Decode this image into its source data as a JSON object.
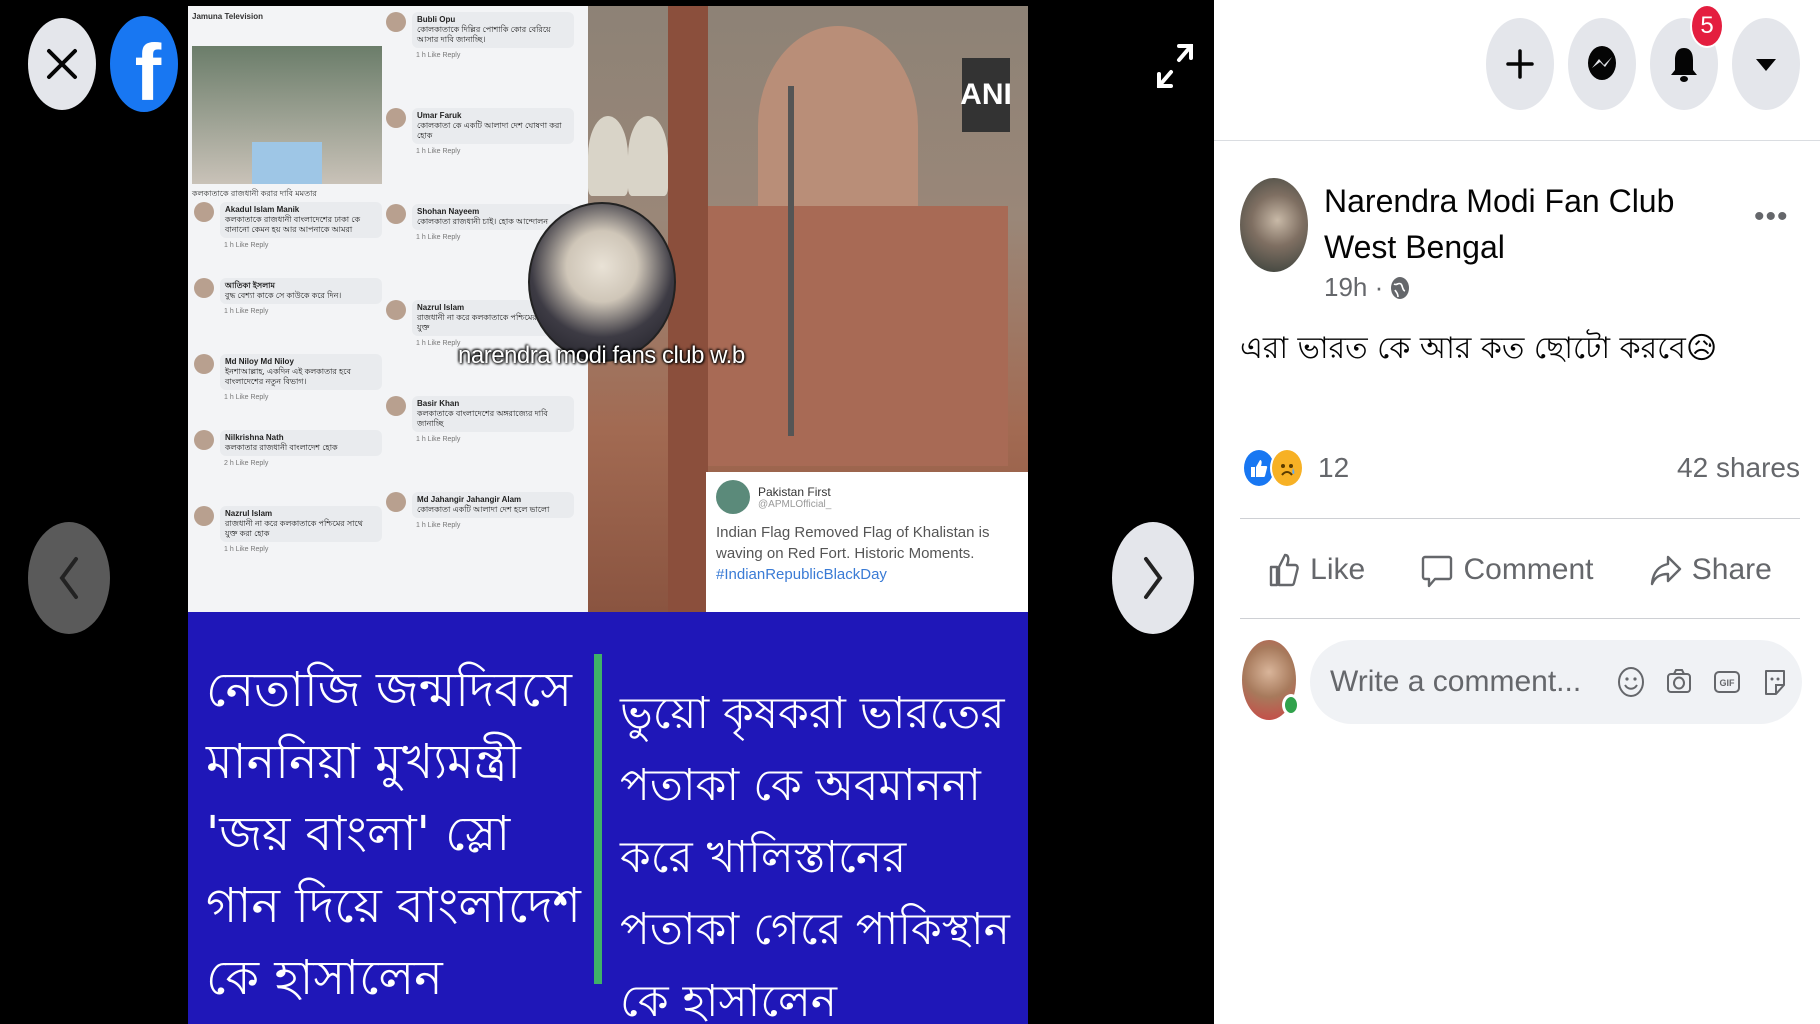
{
  "viewer": {
    "close_icon": "close-icon",
    "logo_icon": "facebook-logo",
    "logo_letter": "f",
    "expand_icon": "expand-icon",
    "prev_icon": "chevron-left-icon",
    "next_icon": "chevron-right-icon"
  },
  "post_image": {
    "news_header": "Jamuna Television",
    "news_caption": "কলকাতাকে রাজধানী করার দাবি মমতার",
    "comments_left": [
      {
        "name": "Akadul Islam Manik",
        "text": "কলকাতাকে রাজধানী বাংলাদেশের ঢাকা কে বানানো কেমন হয় আর আপনাকে আমরা",
        "meta": "1 h   Like   Reply"
      },
      {
        "name": "আতিকা ইসলাম",
        "text": "বুদ্ধ বেশ্যা কাকে সে কাউকে করে দিন।",
        "meta": "1 h   Like   Reply"
      },
      {
        "name": "Md Niloy Md Niloy",
        "text": "ইনশাআল্লাহ, একদিন এই কলকাতার হবে বাংলাদেশের নতুন বিভাগ।",
        "meta": "1 h   Like   Reply"
      },
      {
        "name": "Nilkrishna Nath",
        "text": "কলকাতার রাজধানী বাংলাদেশ হোক",
        "meta": "2 h   Like   Reply"
      },
      {
        "name": "Nazrul Islam",
        "text": "রাজধানী না করে কলকাতাকে পশ্চিমের সাথে যুক্ত করা হোক",
        "meta": "1 h   Like   Reply"
      }
    ],
    "comments_right": [
      {
        "name": "Bubli Opu",
        "text": "কোলকাতাকে দিল্লির পোশাকি কোর বেরিয়ে আসার দাবি জানাচ্ছি।",
        "meta": "1 h   Like   Reply"
      },
      {
        "name": "Umar Faruk",
        "text": "কোলকাতা কে একটি আলাদা দেশ ঘোষণা করা হোক",
        "meta": "1 h   Like   Reply"
      },
      {
        "name": "Shohan Nayeem",
        "text": "কোলকাতা রাজধানী চাই। হোক আন্দোলন",
        "meta": "1 h   Like   Reply"
      },
      {
        "name": "Nazrul Islam",
        "text": "রাজধানী না করে কলকাতাকে পশ্চিমের সাথে যুক্ত",
        "meta": "1 h   Like   Reply"
      },
      {
        "name": "Basir Khan",
        "text": "কলকাতাকে বাংলাদেশের অঙ্গরাজ্যের দাবি জানাচ্ছি",
        "meta": "1 h   Like   Reply"
      },
      {
        "name": "Md Jahangir Jahangir Alam",
        "text": "কোলকাতা একটি আলাদা দেশ হলে ভালো",
        "meta": "1 h   Like   Reply"
      }
    ],
    "overlay_label": "narendra modi fans club w.b",
    "ani_label": "ANI",
    "tweet": {
      "name": "Pakistan First",
      "handle": "@APMLOfficial_",
      "text": "Indian Flag Removed Flag of Khalistan is waving on Red Fort. Historic Moments.",
      "hashtag": "#IndianRepublicBlackDay"
    },
    "caption_left": "নেতাজি জন্মদিবসে মাননিয়া মুখ্যমন্ত্রী 'জয় বাংলা' স্লো গান দিয়ে বাংলাদেশ কে হাসালেন",
    "caption_right": "ভুয়ো কৃষকরা ভারতের পতাকা কে অবমাননা করে খালিস্তানের পতাকা গেরে পাকিস্থান কে হাসালেন",
    "colors": {
      "background": "#1f17b8",
      "divider": "#3fb168"
    }
  },
  "top_bar": {
    "create_icon": "plus-icon",
    "messenger_icon": "messenger-icon",
    "notifications_icon": "bell-icon",
    "notifications_badge": "5",
    "account_icon": "caret-down-icon"
  },
  "post": {
    "author": "Narendra Modi Fan Club West Bengal",
    "time": "19h ·",
    "audience_icon": "globe-icon",
    "more_label": "•••",
    "text": "এরা ভারত কে আর কত ছোটো করবে",
    "text_emoji": "😥",
    "reaction_count": "12",
    "shares": "42 shares",
    "actions": {
      "like": "Like",
      "comment": "Comment",
      "share": "Share"
    },
    "comment_placeholder": "Write a comment..."
  },
  "colors": {
    "brand": "#1877f2",
    "badge": "#e41e3f",
    "muted": "#65676b",
    "online": "#31a24c"
  }
}
